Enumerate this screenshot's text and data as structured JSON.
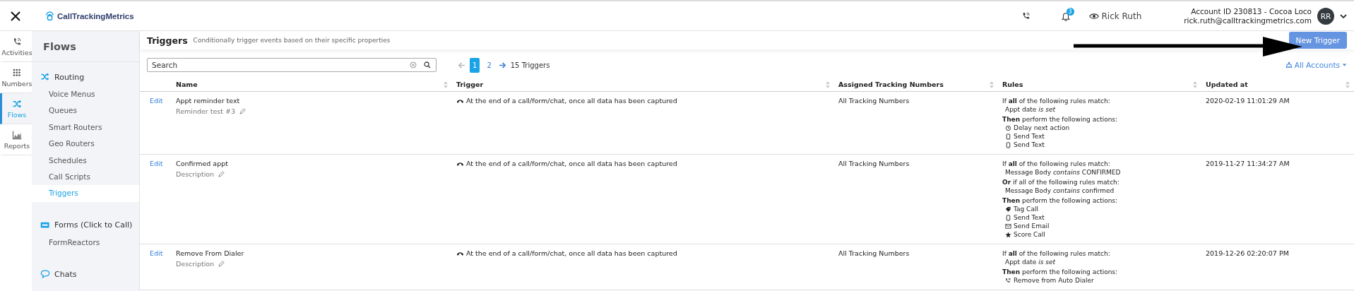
{
  "topbar": {
    "logo": "CallTrackingMetrics",
    "notifications": "3",
    "viewing_as": "Rick Ruth",
    "account": "Account ID 230813  -  Cocoa Loco",
    "email": "rick.ruth@calltrackingmetrics.com",
    "avatar": "RR"
  },
  "rail": [
    {
      "label": "Activities",
      "kind": "phone",
      "selected": false
    },
    {
      "label": "Numbers",
      "kind": "grid",
      "selected": false
    },
    {
      "label": "Flows",
      "kind": "shuffle",
      "selected": true
    },
    {
      "label": "Reports",
      "kind": "chart",
      "selected": false
    }
  ],
  "sidebar": {
    "title": "Flows",
    "sections": [
      {
        "label": "Routing",
        "kind": "shuffle",
        "items": [
          {
            "label": "Voice Menus",
            "selected": false
          },
          {
            "label": "Queues",
            "selected": false
          },
          {
            "label": "Smart Routers",
            "selected": false
          },
          {
            "label": "Geo Routers",
            "selected": false
          },
          {
            "label": "Schedules",
            "selected": false
          },
          {
            "label": "Call Scripts",
            "selected": false
          },
          {
            "label": "Triggers",
            "selected": true
          }
        ]
      },
      {
        "label": "Forms (Click to Call)",
        "kind": "form",
        "items": [
          {
            "label": "FormReactors",
            "selected": false
          }
        ]
      },
      {
        "label": "Chats",
        "kind": "chat"
      }
    ]
  },
  "page": {
    "title": "Triggers",
    "subtitle": "Conditionally trigger events based on their specific properties",
    "new_button": "New Trigger"
  },
  "search": {
    "placeholder": "Search"
  },
  "pager": {
    "pages": [
      {
        "label": "1",
        "selected": true
      },
      {
        "label": "2",
        "selected": false
      }
    ],
    "count": "15 Triggers"
  },
  "accounts_filter": "All Accounts",
  "table": {
    "columns": [
      "Name",
      "Trigger",
      "Assigned Tracking Numbers",
      "Rules",
      "Updated at"
    ],
    "rows": [
      {
        "edit": "Edit",
        "name": "Appt reminder text",
        "description": "Reminder test #3",
        "trigger": "At the end of a call/form/chat, once all data has been captured",
        "numbers": "All Tracking Numbers",
        "updated": "2020-02-19 11:01:29 AM",
        "rules": [
          {
            "kind": "heading",
            "text": "If **all** of the following rules match:"
          },
          {
            "kind": "condition",
            "text": "Appt date *is set*"
          },
          {
            "kind": "heading",
            "text": "**Then** perform the following actions:"
          },
          {
            "kind": "clock",
            "text": "Delay next action"
          },
          {
            "kind": "mobile",
            "text": "Send Text"
          },
          {
            "kind": "mobile",
            "text": "Send Text"
          }
        ]
      },
      {
        "edit": "Edit",
        "name": "Confirmed appt",
        "description": "Description",
        "trigger": "At the end of a call/form/chat, once all data has been captured",
        "numbers": "All Tracking Numbers",
        "updated": "2019-11-27 11:34:27 AM",
        "rules": [
          {
            "kind": "heading",
            "text": "If **all** of the following rules match:"
          },
          {
            "kind": "condition",
            "text": "Message Body *contains* CONFIRMED"
          },
          {
            "kind": "heading",
            "text": "**Or** if all of the following rules match:"
          },
          {
            "kind": "condition",
            "text": "Message Body *contains* confirmed"
          },
          {
            "kind": "heading",
            "text": "**Then** perform the following actions:"
          },
          {
            "kind": "tag",
            "text": "Tag Call"
          },
          {
            "kind": "mobile",
            "text": "Send Text"
          },
          {
            "kind": "mail",
            "text": "Send Email"
          },
          {
            "kind": "star",
            "text": "Score Call"
          }
        ]
      },
      {
        "edit": "Edit",
        "name": "Remove From Dialer",
        "description": "Description",
        "trigger": "At the end of a call/form/chat, once all data has been captured",
        "numbers": "All Tracking Numbers",
        "updated": "2019-12-26 02:20:07 PM",
        "rules": [
          {
            "kind": "heading",
            "text": "If **all** of the following rules match:"
          },
          {
            "kind": "condition",
            "text": "Appt date *is set*"
          },
          {
            "kind": "heading",
            "text": "**Then** perform the following actions:"
          },
          {
            "kind": "nodial",
            "text": "Remove from Auto Dialer"
          }
        ]
      }
    ]
  }
}
